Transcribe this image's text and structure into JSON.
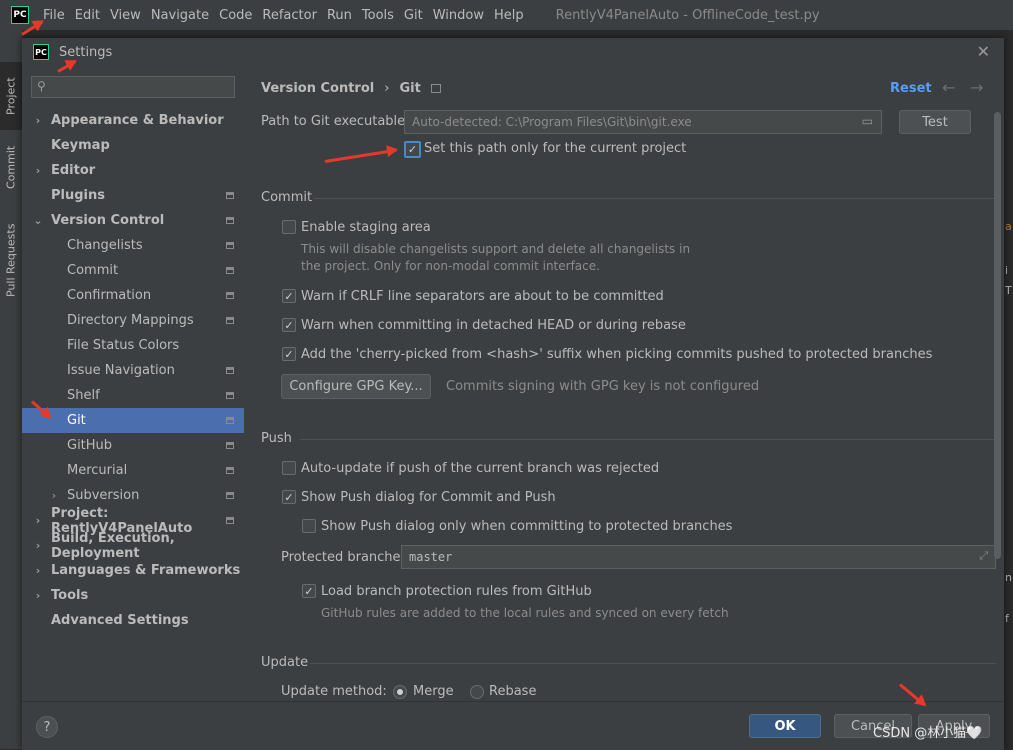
{
  "ide": {
    "logo": "PC",
    "menu": [
      "File",
      "Edit",
      "View",
      "Navigate",
      "Code",
      "Refactor",
      "Run",
      "Tools",
      "Git",
      "Window",
      "Help"
    ],
    "window_title": "RentlyV4PanelAuto - OfflineCode_test.py",
    "side_tabs": [
      "Project",
      "Commit",
      "Pull Requests"
    ],
    "editor_chars": [
      "a",
      "i",
      "T",
      "n",
      "f"
    ]
  },
  "dialog": {
    "title": "Settings",
    "close_icon": "close-icon",
    "search": {
      "placeholder": "",
      "icon": "search-icon"
    },
    "tree": [
      {
        "label": "Appearance & Behavior",
        "bold": true,
        "chevron": "right",
        "level": 0,
        "icon": false
      },
      {
        "label": "Keymap",
        "bold": true,
        "chevron": "",
        "level": 0,
        "icon": false
      },
      {
        "label": "Editor",
        "bold": true,
        "chevron": "right",
        "level": 0,
        "icon": false
      },
      {
        "label": "Plugins",
        "bold": true,
        "chevron": "",
        "level": 0,
        "icon": true
      },
      {
        "label": "Version Control",
        "bold": true,
        "chevron": "down",
        "level": 0,
        "icon": true
      },
      {
        "label": "Changelists",
        "bold": false,
        "chevron": "",
        "level": 1,
        "icon": true
      },
      {
        "label": "Commit",
        "bold": false,
        "chevron": "",
        "level": 1,
        "icon": true
      },
      {
        "label": "Confirmation",
        "bold": false,
        "chevron": "",
        "level": 1,
        "icon": true
      },
      {
        "label": "Directory Mappings",
        "bold": false,
        "chevron": "",
        "level": 1,
        "icon": true
      },
      {
        "label": "File Status Colors",
        "bold": false,
        "chevron": "",
        "level": 1,
        "icon": false
      },
      {
        "label": "Issue Navigation",
        "bold": false,
        "chevron": "",
        "level": 1,
        "icon": true
      },
      {
        "label": "Shelf",
        "bold": false,
        "chevron": "",
        "level": 1,
        "icon": true
      },
      {
        "label": "Git",
        "bold": false,
        "chevron": "",
        "level": 1,
        "icon": true,
        "selected": true
      },
      {
        "label": "GitHub",
        "bold": false,
        "chevron": "",
        "level": 1,
        "icon": true
      },
      {
        "label": "Mercurial",
        "bold": false,
        "chevron": "",
        "level": 1,
        "icon": true
      },
      {
        "label": "Subversion",
        "bold": false,
        "chevron": "right",
        "level": 1,
        "icon": true
      },
      {
        "label": "Project: RentlyV4PanelAuto",
        "bold": true,
        "chevron": "right",
        "level": 0,
        "icon": true
      },
      {
        "label": "Build, Execution, Deployment",
        "bold": true,
        "chevron": "right",
        "level": 0,
        "icon": false
      },
      {
        "label": "Languages & Frameworks",
        "bold": true,
        "chevron": "right",
        "level": 0,
        "icon": false
      },
      {
        "label": "Tools",
        "bold": true,
        "chevron": "right",
        "level": 0,
        "icon": false
      },
      {
        "label": "Advanced Settings",
        "bold": true,
        "chevron": "",
        "level": 0,
        "icon": false
      }
    ],
    "breadcrumb": {
      "parent": "Version Control",
      "sep": "›",
      "current": "Git"
    },
    "reset": "Reset",
    "back_icon": "←",
    "forward_icon": "→",
    "git_path": {
      "label": "Path to Git executable:",
      "value": "Auto-detected: C:\\Program Files\\Git\\bin\\git.exe",
      "test": "Test",
      "current_project_only": "Set this path only for the current project",
      "current_project_only_checked": true
    },
    "commit": {
      "heading": "Commit",
      "staging": "Enable staging area",
      "staging_checked": false,
      "staging_hint_1": "This will disable changelists support and delete all changelists in",
      "staging_hint_2": "the project. Only for non-modal commit interface.",
      "crlf": "Warn if CRLF line separators are about to be committed",
      "crlf_checked": true,
      "detached": "Warn when committing in detached HEAD or during rebase",
      "detached_checked": true,
      "cherry": "Add the 'cherry-picked from <hash>' suffix when picking commits pushed to protected branches",
      "cherry_checked": true,
      "gpg_button": "Configure GPG Key...",
      "gpg_status": "Commits signing with GPG key is not configured"
    },
    "push": {
      "heading": "Push",
      "auto_update": "Auto-update if push of the current branch was rejected",
      "auto_update_checked": false,
      "show_dialog": "Show Push dialog for Commit and Push",
      "show_dialog_checked": true,
      "protected_only": "Show Push dialog only when committing to protected branches",
      "protected_only_checked": false,
      "protected_label": "Protected branches:",
      "protected_value": "master",
      "load_rules": "Load branch protection rules from GitHub",
      "load_rules_checked": true,
      "load_rules_hint": "GitHub rules are added to the local rules and synced on every fetch"
    },
    "update": {
      "heading": "Update",
      "method_label": "Update method:",
      "merge": "Merge",
      "rebase": "Rebase",
      "selected": "Merge"
    },
    "footer": {
      "help": "?",
      "ok": "OK",
      "cancel": "Cancel",
      "apply": "Apply"
    }
  },
  "watermark": "CSDN @林小猫🤍",
  "colors": {
    "accent": "#4b6eaf",
    "link": "#589df6",
    "annotation": "#e53a2b",
    "ok": "#365880"
  }
}
